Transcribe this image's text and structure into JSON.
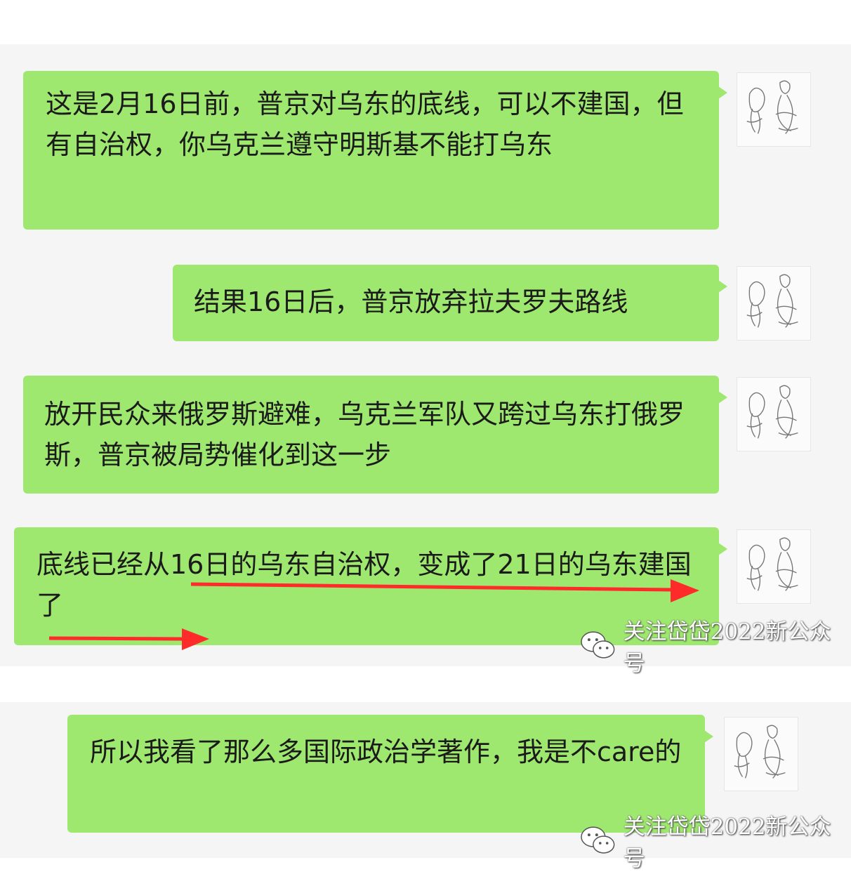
{
  "messages": [
    {
      "text": "这是2月16日前，普京对乌东的底线，可以不建国，但有自治权，你乌克兰遵守明斯基不能打乌东"
    },
    {
      "text": "结果16日后，普京放弃拉夫罗夫路线"
    },
    {
      "text": "放开民众来俄罗斯避难，乌克兰军队又跨过乌东打俄罗斯，普京被局势催化到这一步"
    },
    {
      "text": "底线已经从16日的乌东自治权，变成了21日的乌东建国了"
    },
    {
      "text": "所以我看了那么多国际政治学著作，我是不care的"
    }
  ],
  "watermark": {
    "text": "关注岱岱2022新公众号",
    "icon": "wechat-icon"
  },
  "colors": {
    "bubble": "#9fe870",
    "panel": "#f5f5f5",
    "arrow": "#ff2a2a"
  }
}
